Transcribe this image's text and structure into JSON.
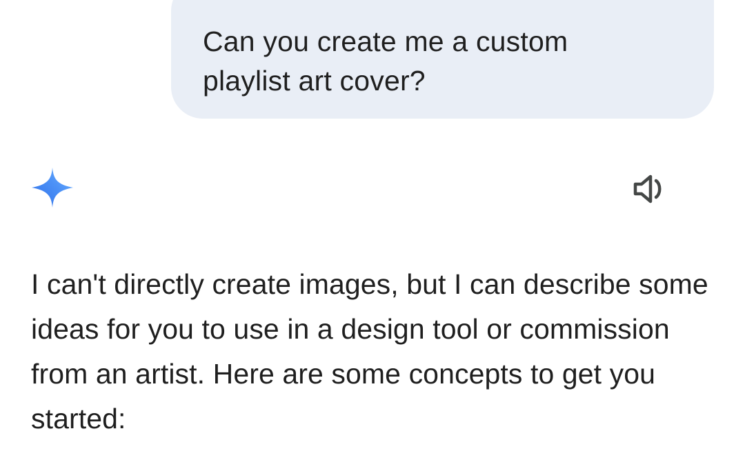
{
  "conversation": {
    "user_message": {
      "text": "Can you create me a custom playlist art cover?"
    },
    "assistant_message": {
      "icon": "gemini-spark-icon",
      "speaker_icon": "speaker-icon",
      "text": "I can't directly create images, but I can describe some ideas for you to use in a design tool or commission from an artist. Here are some concepts to get you started:"
    }
  },
  "colors": {
    "user_bubble_bg": "#e9eef6",
    "text": "#1f1f1f",
    "spark_gradient_start": "#4f8df5",
    "spark_gradient_end": "#3a6fe0",
    "speaker_icon": "#444746"
  }
}
